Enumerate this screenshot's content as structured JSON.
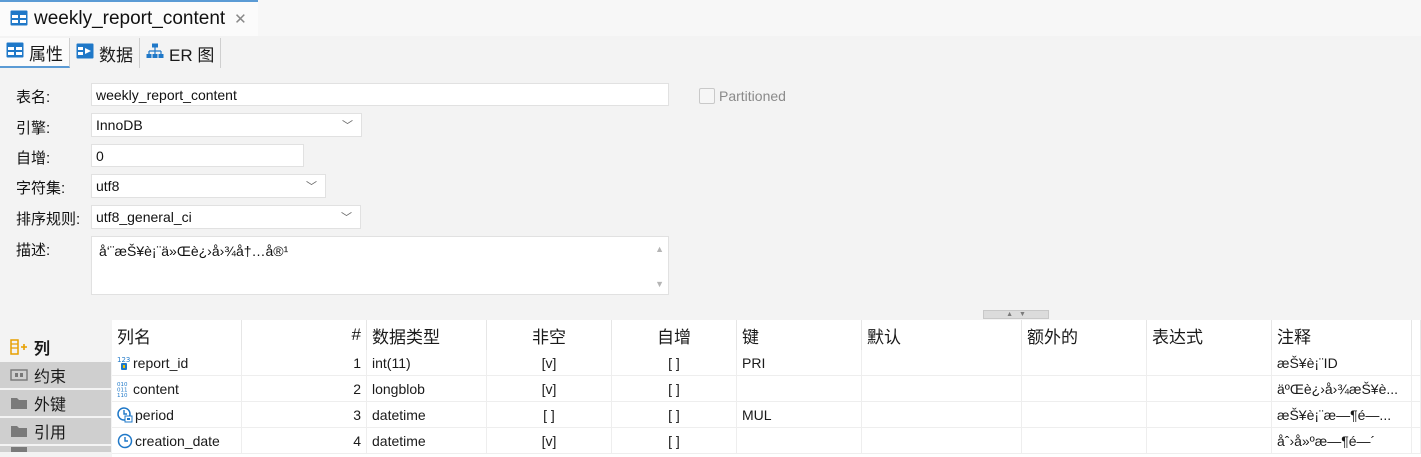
{
  "editor_tab": {
    "title": "weekly_report_content",
    "close_glyph": "✕",
    "icon": "table-icon"
  },
  "subtabs": [
    {
      "label": "属性",
      "icon": "table-icon",
      "active": true
    },
    {
      "label": "数据",
      "icon": "data-grid-icon",
      "active": false
    },
    {
      "label": "ER 图",
      "icon": "er-diagram-icon",
      "active": false
    }
  ],
  "properties": {
    "table_name": {
      "label": "表名:",
      "value": "weekly_report_content"
    },
    "engine": {
      "label": "引擎:",
      "value": "InnoDB"
    },
    "auto_increment": {
      "label": "自增:",
      "value": "0"
    },
    "charset": {
      "label": "字符集:",
      "value": "utf8"
    },
    "collation": {
      "label": "排序规则:",
      "value": "utf8_general_ci"
    },
    "description": {
      "label": "描述:",
      "value": "å‘¨æŠ¥è¡¨ä»Œè¿›å›¾å†…å®¹"
    },
    "partitioned": {
      "label": "Partitioned",
      "checked": false
    }
  },
  "side_tabs": [
    {
      "label": "列",
      "icon": "add-column-icon",
      "active": true
    },
    {
      "label": "约束",
      "icon": "constraint-icon",
      "active": false
    },
    {
      "label": "外键",
      "icon": "folder-icon",
      "active": false
    },
    {
      "label": "引用",
      "icon": "folder-icon",
      "active": false
    }
  ],
  "grid": {
    "headers": {
      "name": "列名",
      "num": "#",
      "type": "数据类型",
      "not_null": "非空",
      "auto_inc": "自增",
      "key": "键",
      "default": "默认",
      "extra": "额外的",
      "expression": "表达式",
      "comment": "注释"
    },
    "rows": [
      {
        "icon": "numeric-key-icon",
        "name": "report_id",
        "num": "1",
        "type": "int(11)",
        "not_null": "[v]",
        "auto_inc": "[ ]",
        "key": "PRI",
        "default": "",
        "extra": "",
        "expression": "",
        "comment": "æŠ¥è¡¨ID"
      },
      {
        "icon": "binary-column-icon",
        "name": "content",
        "num": "2",
        "type": "longblob",
        "not_null": "[v]",
        "auto_inc": "[ ]",
        "key": "",
        "default": "",
        "extra": "",
        "expression": "",
        "comment": "äºŒè¿›å›¾æŠ¥è..."
      },
      {
        "icon": "datetime-index-icon",
        "name": "period",
        "num": "3",
        "type": "datetime",
        "not_null": "[ ]",
        "auto_inc": "[ ]",
        "key": "MUL",
        "default": "",
        "extra": "",
        "expression": "",
        "comment": "æŠ¥è¡¨æ—¶é—..."
      },
      {
        "icon": "clock-icon",
        "name": "creation_date",
        "num": "4",
        "type": "datetime",
        "not_null": "[v]",
        "auto_inc": "[ ]",
        "key": "",
        "default": "",
        "extra": "",
        "expression": "",
        "comment": "åˆ›å»ºæ—¶é—´"
      }
    ]
  },
  "colors": {
    "accent": "#5b9bd5",
    "icon_blue": "#1f78c8",
    "background": "#f3f3f3"
  }
}
